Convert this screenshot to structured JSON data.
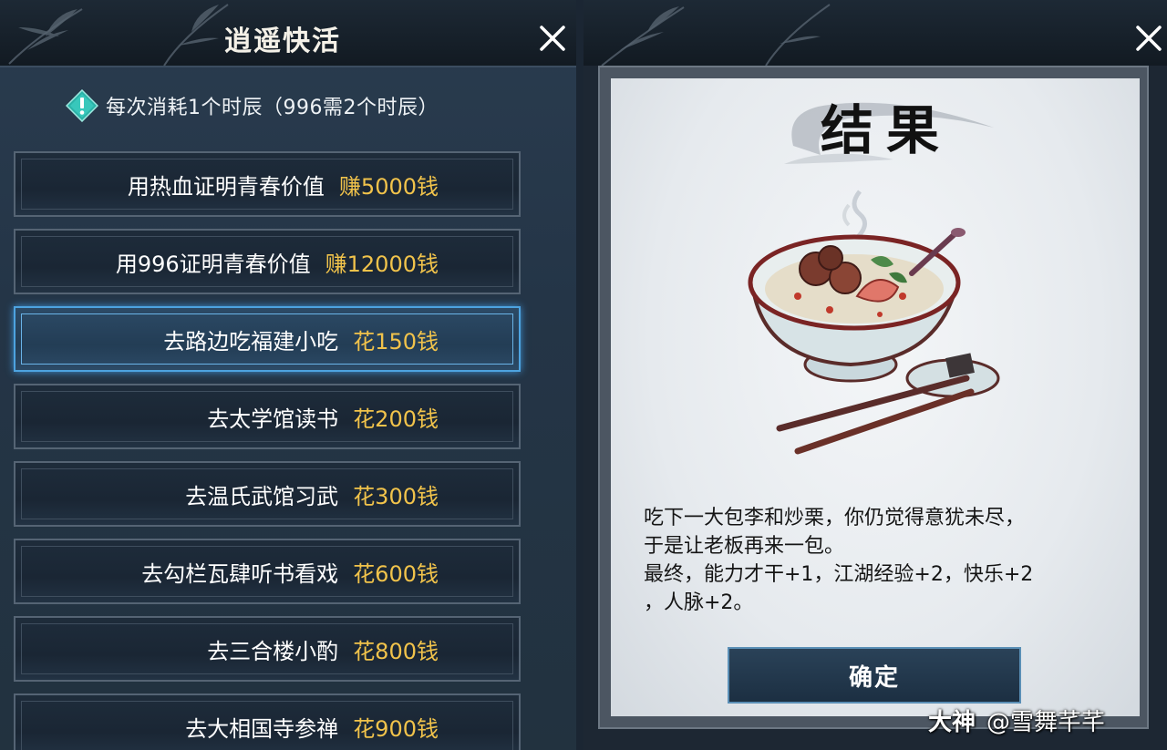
{
  "left_panel": {
    "title": "逍遥快活",
    "notice": "每次消耗1个时辰（996需2个时辰）",
    "options": [
      {
        "label": "用热血证明青春价值",
        "cost": "赚5000钱"
      },
      {
        "label": "用996证明青春价值",
        "cost": "赚12000钱"
      },
      {
        "label": "去路边吃福建小吃",
        "cost": "花150钱",
        "selected": true
      },
      {
        "label": "去太学馆读书",
        "cost": "花200钱"
      },
      {
        "label": "去温氏武馆习武",
        "cost": "花300钱"
      },
      {
        "label": "去勾栏瓦肆听书看戏",
        "cost": "花600钱"
      },
      {
        "label": "去三合楼小酌",
        "cost": "花800钱"
      },
      {
        "label": "去大相国寺参禅",
        "cost": "花900钱"
      }
    ]
  },
  "result_panel": {
    "title": "结果",
    "text_lines": [
      "吃下一大包李和炒栗，你仍觉得意犹未尽，",
      "于是让老板再来一包。",
      "最终，能力才干+1，江湖经验+2，快乐+2",
      "，人脉+2。"
    ],
    "confirm_label": "确定"
  },
  "watermark": {
    "brand": "大神",
    "user": "@雪舞芊芊"
  },
  "colors": {
    "cost_gold": "#f1c34b",
    "selected_border": "#4da3e0"
  },
  "icons": [
    "close-icon",
    "info-diamond-icon",
    "bamboo-decoration",
    "food-bowl-illustration"
  ]
}
